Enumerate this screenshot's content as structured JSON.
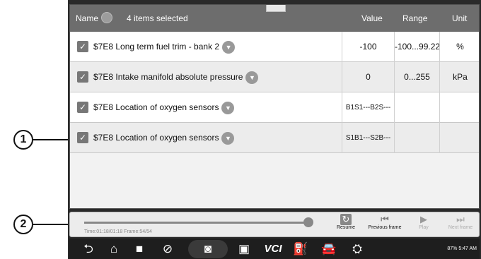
{
  "callouts": [
    "1",
    "2"
  ],
  "header": {
    "name_label": "Name",
    "selected_text": "4 items selected",
    "value_label": "Value",
    "range_label": "Range",
    "unit_label": "Unit"
  },
  "rows": [
    {
      "name": "$7E8 Long term fuel trim - bank 2",
      "value": "-100",
      "range": "-100...99.22",
      "unit": "%",
      "checked": true
    },
    {
      "name": "$7E8 Intake manifold absolute pressure",
      "value": "0",
      "range": "0...255",
      "unit": "kPa",
      "checked": true
    },
    {
      "name": "$7E8 Location of oxygen sensors",
      "value": "B1S1---B2S---",
      "range": "",
      "unit": "",
      "checked": true
    },
    {
      "name": "$7E8 Location of oxygen sensors",
      "value": "S1B1---S2B---",
      "range": "",
      "unit": "",
      "checked": true
    }
  ],
  "playback": {
    "time_info": "Time:01:18/01:18  Frame:54/54",
    "progress_percent": 100,
    "resume_label": "Resume",
    "previous_label": "Previous frame",
    "play_label": "Play",
    "next_label": "Next frame"
  },
  "navbar": {
    "status_text": "87% 5:47 AM",
    "vci_label": "VCI",
    "icons": [
      "back-icon",
      "home-icon",
      "recent-apps-icon",
      "browser-icon",
      "camera-icon",
      "screenshot-icon",
      "vci-icon",
      "fuel-pump-icon",
      "car-icon",
      "mechanic-icon"
    ]
  }
}
